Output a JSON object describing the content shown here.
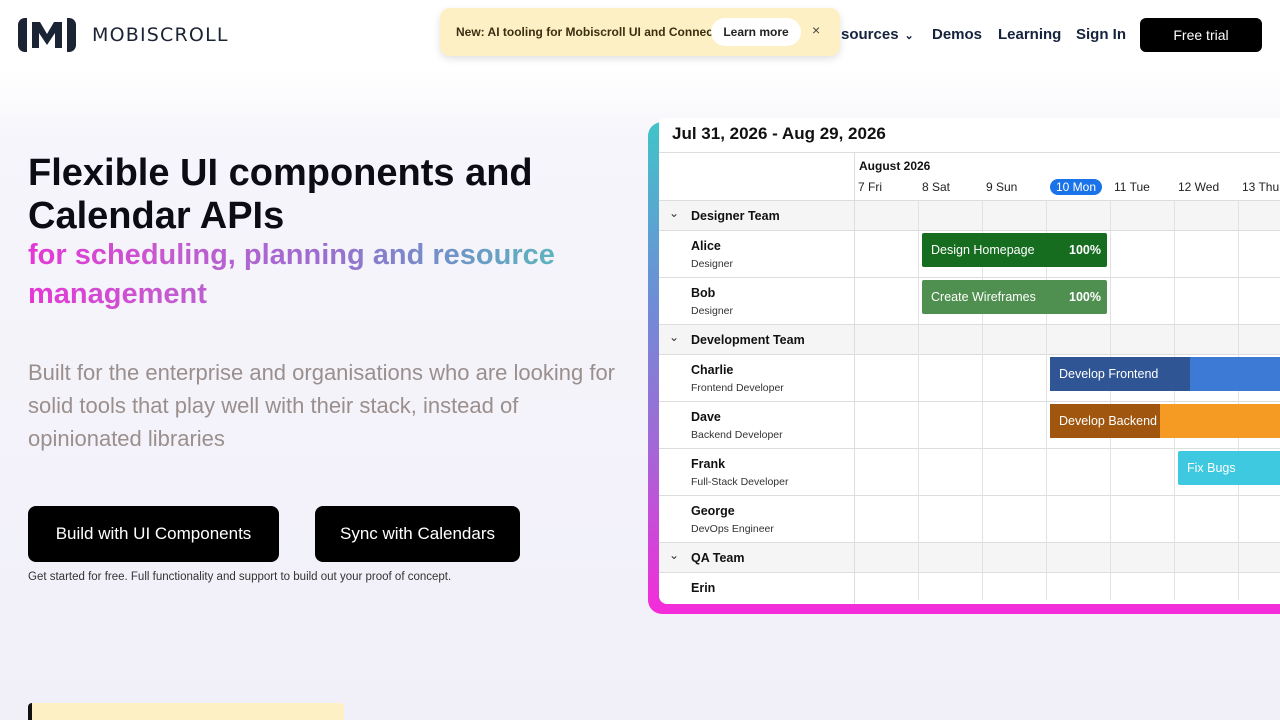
{
  "header": {
    "logo_text": "MOBISCROLL",
    "nav": [
      {
        "label": "sources",
        "has_chevron": true
      },
      {
        "label": "Demos"
      },
      {
        "label": "Learning"
      },
      {
        "label": "Sign In"
      }
    ],
    "cta_label": "Free trial"
  },
  "banner": {
    "text": "New: AI tooling for Mobiscroll UI and Connect",
    "button_label": "Learn more",
    "close_glyph": "×"
  },
  "hero": {
    "title": "Flexible UI components and Calendar APIs",
    "subtitle": "for scheduling, planning and resource management",
    "description": "Built for the enterprise and organisations who are looking for solid tools that play well with their stack, instead of opinionated libraries",
    "buttons": [
      "Build with UI Components",
      "Sync with Calendars"
    ],
    "note": "Get started for free. Full functionality and support to build out your proof of concept."
  },
  "calendar": {
    "range": "Jul 31, 2026 - Aug 29, 2026",
    "month": "August 2026",
    "days": [
      "7 Fri",
      "8 Sat",
      "9 Sun",
      "10 Mon",
      "11 Tue",
      "12 Wed",
      "13 Thu"
    ],
    "today_index": 3,
    "groups": [
      {
        "name": "Designer Team"
      },
      {
        "name": "Development Team"
      },
      {
        "name": "QA Team"
      }
    ],
    "resources": [
      {
        "name": "Alice",
        "role": "Designer"
      },
      {
        "name": "Bob",
        "role": "Designer"
      },
      {
        "name": "Charlie",
        "role": "Frontend Developer"
      },
      {
        "name": "Dave",
        "role": "Backend Developer"
      },
      {
        "name": "Frank",
        "role": "Full-Stack Developer"
      },
      {
        "name": "George",
        "role": "DevOps Engineer"
      },
      {
        "name": "Erin",
        "role": ""
      }
    ],
    "events": [
      {
        "title": "Design Homepage",
        "progress": "100%",
        "color": "#166d1f"
      },
      {
        "title": "Create Wireframes",
        "progress": "100%",
        "color": "#4f8f4f"
      },
      {
        "title": "Develop Frontend",
        "progress": "",
        "color": "#2f5595",
        "rest_color": "#3d7ad6"
      },
      {
        "title": "Develop Backend",
        "progress": "",
        "color": "#a0560f",
        "rest_color": "#f59a23"
      },
      {
        "title": "Fix Bugs",
        "progress": "",
        "color": "#3ec9e0"
      }
    ],
    "chevron_glyph": "⌄"
  }
}
